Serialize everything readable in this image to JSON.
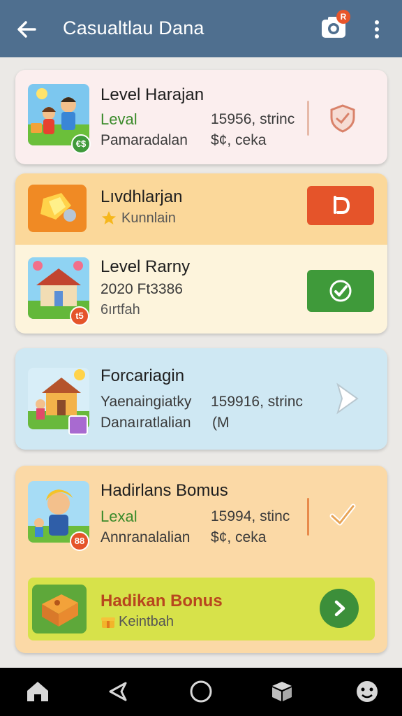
{
  "app_bar": {
    "title": "Casualtlau Dana",
    "camera_badge": "R",
    "icons": [
      "back-arrow-icon",
      "camera-icon",
      "more-vertical-icon"
    ]
  },
  "cards": [
    {
      "rows": [
        {
          "title": "Level Harajan",
          "line1_left": "Leval",
          "line1_right": "15956, strinc",
          "line2_left": "Pamaradalan",
          "line2_right": "$¢, ceka",
          "badge": "€$",
          "action_icon": "shield-check-icon"
        }
      ]
    },
    {
      "rows": [
        {
          "title": "Lıvdhlarjan",
          "line1_left": "Kunnlain",
          "action_icon": "refresh-icon",
          "action_color": "#e5542a"
        },
        {
          "title": "Level Rarny",
          "line1_left": "2020 Ft3386",
          "line2_left": "6ırtfah",
          "badge": "t5",
          "action_icon": "check-icon",
          "action_color": "#3f9a3a"
        }
      ]
    },
    {
      "rows": [
        {
          "title": "Forcariagin",
          "line1_left": "Yaenaingiatky",
          "line1_right": "159916, strinc",
          "line2_left": "Danaıratlalian",
          "line2_right": "(M",
          "action_icon": "chevron-right-icon"
        }
      ]
    },
    {
      "rows": [
        {
          "title": "Hadirlans Bomus",
          "line1_left": "Lexal",
          "line1_right": "15994, stinc",
          "line2_left": "Annranalalian",
          "line2_right": "$¢, ceka",
          "badge": "88",
          "action_icon": "check-icon"
        },
        {
          "title": "Hadikan Bonus",
          "line1_left": "Keintbah",
          "action_icon": "chevron-right-icon",
          "action_color": "#3c8f3a"
        }
      ]
    }
  ],
  "colors": {
    "app_bar": "#4f6f8f",
    "card1": "#fbeeee",
    "card2_top": "#fbd89a",
    "card2_bottom": "#fdf4dc",
    "card3": "#cfe8f3",
    "card4_top": "#fbd9a6",
    "card4_bottom": "#d7e24a",
    "accent_orange": "#e5542a",
    "accent_green": "#3f9a3a"
  },
  "nav_bar": {
    "icons": [
      "home-icon",
      "back-triangle-icon",
      "circle-home-icon",
      "box-icon",
      "assistant-icon"
    ]
  }
}
